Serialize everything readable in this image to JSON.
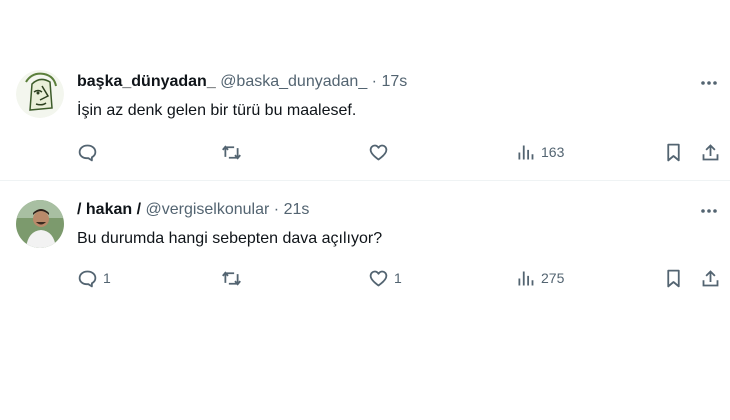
{
  "tweets": [
    {
      "display_name": "başka_dünyadan_",
      "handle": "@baska_dunyadan_",
      "separator": "·",
      "time": "17s",
      "text": "İşin az denk gelen bir türü bu maalesef.",
      "replies": "",
      "retweets": "",
      "likes": "",
      "views": "163",
      "avatar_icon": "drawn-face-avatar"
    },
    {
      "display_name": "/ hakan /",
      "handle": "@vergiselkonular",
      "separator": "·",
      "time": "21s",
      "text": "Bu durumda hangi sebepten dava açılıyor?",
      "replies": "1",
      "retweets": "",
      "likes": "1",
      "views": "275",
      "avatar_icon": "photo-avatar"
    }
  ],
  "colors": {
    "text_primary": "#0f1419",
    "text_secondary": "#536471",
    "divider": "#eff3f4"
  }
}
